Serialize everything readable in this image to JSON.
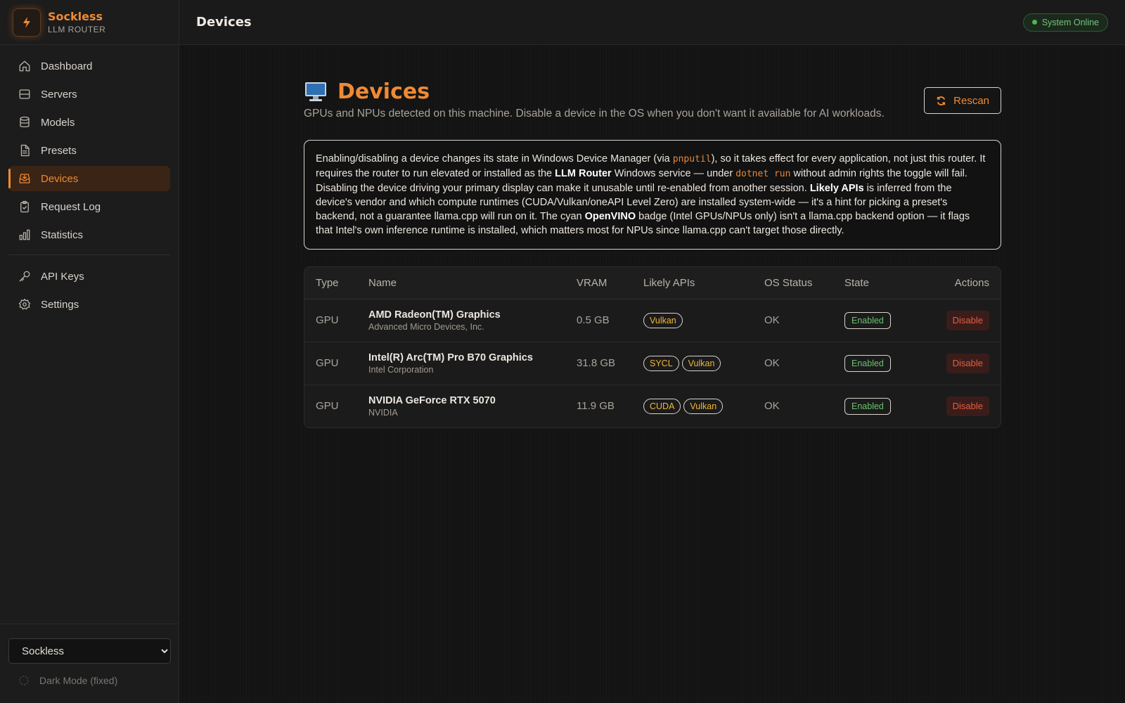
{
  "brand": {
    "name": "Sockless",
    "subtitle": "LLM ROUTER",
    "logo_icon": "bolt-icon",
    "accent": "#f08a32"
  },
  "nav": {
    "items": [
      {
        "label": "Dashboard",
        "icon": "home-icon"
      },
      {
        "label": "Servers",
        "icon": "server-icon"
      },
      {
        "label": "Models",
        "icon": "database-icon"
      },
      {
        "label": "Presets",
        "icon": "file-icon"
      },
      {
        "label": "Devices",
        "icon": "devices-icon",
        "active": true
      },
      {
        "label": "Request Log",
        "icon": "clipboard-icon"
      },
      {
        "label": "Statistics",
        "icon": "bar-chart-icon"
      }
    ],
    "secondary": [
      {
        "label": "API Keys",
        "icon": "key-icon"
      },
      {
        "label": "Settings",
        "icon": "gear-icon"
      }
    ]
  },
  "tenant_select": {
    "value": "Sockless",
    "options": [
      "Sockless"
    ]
  },
  "dark_mode_label": "Dark Mode (fixed)",
  "topbar": {
    "title": "Devices",
    "status": "System Online",
    "status_color": "#4fb357"
  },
  "page": {
    "title": "Devices",
    "subtitle": "GPUs and NPUs detected on this machine. Disable a device in the OS when you don't want it available for AI workloads.",
    "rescan_label": "Rescan"
  },
  "info": {
    "p1": "Enabling/disabling a device changes its state in Windows Device Manager (via ",
    "code1": "pnputil",
    "p2": "), so it takes effect for every application, not just this router. It requires the router to run elevated or installed as the ",
    "b1": "LLM Router",
    "p3": " Windows service — under ",
    "code2": "dotnet run",
    "p4": " without admin rights the toggle will fail. Disabling the device driving your primary display can make it unusable until re-enabled from another session. ",
    "b2": "Likely APIs",
    "p5": " is inferred from the device's vendor and which compute runtimes (CUDA/Vulkan/oneAPI Level Zero) are installed system-wide — it's a hint for picking a preset's backend, not a guarantee llama.cpp will run on it. The cyan ",
    "b3": "OpenVINO",
    "p6": " badge (Intel GPUs/NPUs only) isn't a llama.cpp backend option — it flags that Intel's own inference runtime is installed, which matters most for NPUs since llama.cpp can't target those directly."
  },
  "table": {
    "headers": {
      "type": "Type",
      "name": "Name",
      "vram": "VRAM",
      "apis": "Likely APIs",
      "os_status": "OS Status",
      "state": "State",
      "actions": "Actions"
    },
    "rows": [
      {
        "type": "GPU",
        "name": "AMD Radeon(TM) Graphics",
        "vendor": "Advanced Micro Devices, Inc.",
        "vram": "0.5 GB",
        "apis": [
          "Vulkan"
        ],
        "os_status": "OK",
        "state": "Enabled",
        "action": "Disable"
      },
      {
        "type": "GPU",
        "name": "Intel(R) Arc(TM) Pro B70 Graphics",
        "vendor": "Intel Corporation",
        "vram": "31.8 GB",
        "apis": [
          "SYCL",
          "Vulkan"
        ],
        "os_status": "OK",
        "state": "Enabled",
        "action": "Disable"
      },
      {
        "type": "GPU",
        "name": "NVIDIA GeForce RTX 5070",
        "vendor": "NVIDIA",
        "vram": "11.9 GB",
        "apis": [
          "CUDA",
          "Vulkan"
        ],
        "os_status": "OK",
        "state": "Enabled",
        "action": "Disable"
      }
    ]
  }
}
